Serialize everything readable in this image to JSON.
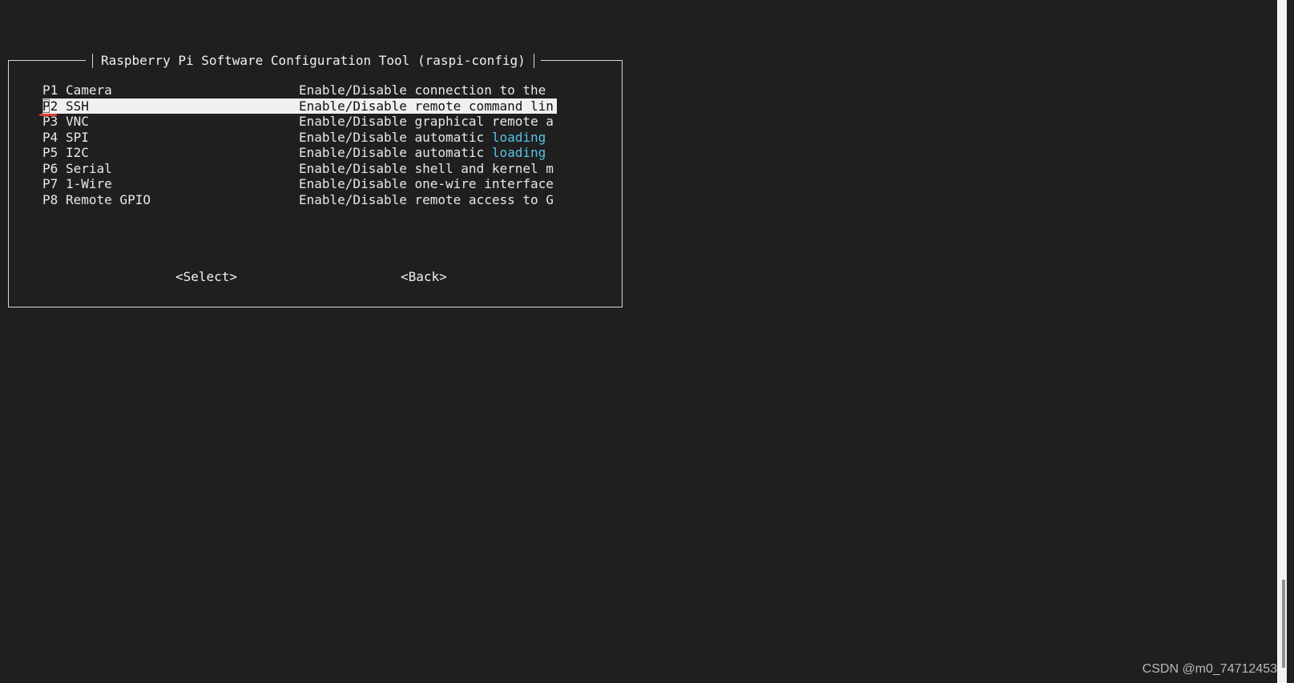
{
  "dialog": {
    "title": "Raspberry Pi Software Configuration Tool (raspi-config)"
  },
  "menu": {
    "selected_index": 1,
    "items": [
      {
        "code": "P1",
        "name": "Camera",
        "desc_before": "Enable/Disable connection to the",
        "desc_highlight": "",
        "desc_after": ""
      },
      {
        "code": "P2",
        "name": "SSH",
        "desc_before": "Enable/Disable remote command lin",
        "desc_highlight": "",
        "desc_after": ""
      },
      {
        "code": "P3",
        "name": "VNC",
        "desc_before": "Enable/Disable graphical remote a",
        "desc_highlight": "",
        "desc_after": ""
      },
      {
        "code": "P4",
        "name": "SPI",
        "desc_before": "Enable/Disable automatic ",
        "desc_highlight": "loading",
        "desc_after": ""
      },
      {
        "code": "P5",
        "name": "I2C",
        "desc_before": "Enable/Disable automatic ",
        "desc_highlight": "loading",
        "desc_after": ""
      },
      {
        "code": "P6",
        "name": "Serial",
        "desc_before": "Enable/Disable shell and kernel m",
        "desc_highlight": "",
        "desc_after": ""
      },
      {
        "code": "P7",
        "name": "1-Wire",
        "desc_before": "Enable/Disable one-wire interface",
        "desc_highlight": "",
        "desc_after": ""
      },
      {
        "code": "P8",
        "name": "Remote GPIO",
        "desc_before": "Enable/Disable remote access to G",
        "desc_highlight": "",
        "desc_after": ""
      }
    ]
  },
  "buttons": {
    "select_label": "<Select>",
    "back_label": "<Back>"
  },
  "watermark": {
    "text": "CSDN @m0_74712453"
  },
  "colors": {
    "background": "#1f1f1f",
    "text": "#e8e8e8",
    "highlight_background": "#f0f0f0",
    "keyword_blue": "#58c3e6",
    "annotation_red": "#e53935"
  }
}
